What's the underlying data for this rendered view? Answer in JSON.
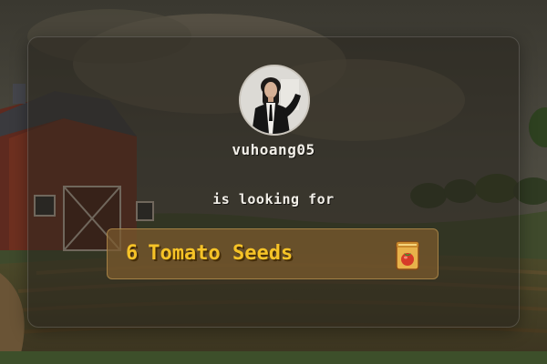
{
  "profile": {
    "username": "vuhoang05"
  },
  "request": {
    "intro_text": "is looking for",
    "quantity": "6",
    "item_name": "Tomato Seeds",
    "item_icon": "tomato-seed-packet-icon"
  },
  "colors": {
    "highlight_text": "#f6c327",
    "body_text": "#f2efe8",
    "request_box": "#7d5c2e"
  }
}
